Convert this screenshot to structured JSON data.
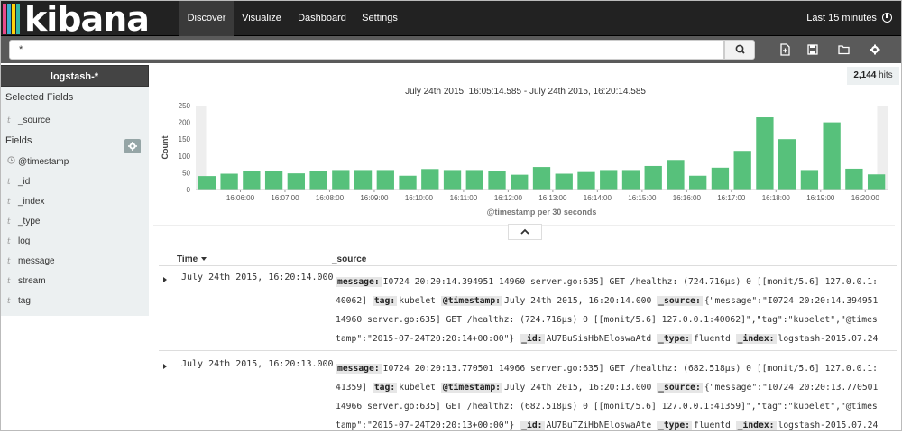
{
  "app": {
    "logo_text": "kibana",
    "logo_colors": [
      "#e8488b",
      "#3caed2",
      "#fed10a",
      "#32b8a6"
    ]
  },
  "nav": {
    "items": [
      {
        "label": "Discover",
        "active": true
      },
      {
        "label": "Visualize",
        "active": false
      },
      {
        "label": "Dashboard",
        "active": false
      },
      {
        "label": "Settings",
        "active": false
      }
    ],
    "time_range": "Last 15 minutes",
    "time_icon": "clock-icon"
  },
  "search": {
    "query": "*",
    "button_icon": "search-icon",
    "tools": [
      "new-search-icon",
      "save-icon",
      "open-icon",
      "settings-icon"
    ]
  },
  "sidebar": {
    "index_pattern": "logstash-*",
    "selected_fields_heading": "Selected Fields",
    "selected_fields": [
      {
        "type": "t",
        "name": "_source"
      }
    ],
    "fields_heading": "Fields",
    "gear_icon": "gear-icon",
    "fields": [
      {
        "type": "clock",
        "name": "@timestamp"
      },
      {
        "type": "t",
        "name": "_id"
      },
      {
        "type": "t",
        "name": "_index"
      },
      {
        "type": "t",
        "name": "_type"
      },
      {
        "type": "t",
        "name": "log"
      },
      {
        "type": "t",
        "name": "message"
      },
      {
        "type": "t",
        "name": "stream"
      },
      {
        "type": "t",
        "name": "tag"
      }
    ]
  },
  "hits": {
    "count": "2,144",
    "label": "hits"
  },
  "chart_data": {
    "type": "bar",
    "title": "July 24th 2015, 16:05:14.585 - July 24th 2015, 16:20:14.585",
    "xlabel": "@timestamp per 30 seconds",
    "ylabel": "Count",
    "ylim": [
      0,
      250
    ],
    "yticks": [
      0,
      50,
      100,
      150,
      200,
      250
    ],
    "color": "#57c17b",
    "xtick_labels": [
      "16:06:00",
      "16:07:00",
      "16:08:00",
      "16:09:00",
      "16:10:00",
      "16:11:00",
      "16:12:00",
      "16:13:00",
      "16:14:00",
      "16:15:00",
      "16:16:00",
      "16:17:00",
      "16:18:00",
      "16:19:00",
      "16:20:00"
    ],
    "values": [
      40,
      47,
      56,
      56,
      48,
      56,
      58,
      58,
      58,
      41,
      61,
      58,
      58,
      55,
      44,
      67,
      47,
      52,
      58,
      58,
      70,
      88,
      41,
      65,
      115,
      215,
      150,
      58,
      200,
      62,
      45
    ],
    "grid": false
  },
  "toggle_icon": "chevron-up-icon",
  "table": {
    "columns": [
      {
        "label": "Time",
        "sort_icon": "sort-down-icon"
      },
      {
        "label": "_source"
      }
    ],
    "rows": [
      {
        "time": "July 24th 2015, 16:20:14.000",
        "fields": [
          {
            "k": "message:",
            "v": "I0724 20:20:14.394951 14960 server.go:635] GET /healthz: (724.716µs) 0 [[monit/5.6] 127.0.0.1:40062]"
          },
          {
            "k": "tag:",
            "v": "kubelet"
          },
          {
            "k": "@timestamp:",
            "v": "July 24th 2015, 16:20:14.000"
          },
          {
            "k": "_source:",
            "v": "{\"message\":\"I0724 20:20:14.394951 14960 server.go:635] GET /healthz: (724.716µs) 0 [[monit/5.6] 127.0.0.1:40062]\",\"tag\":\"kubelet\",\"@timestamp\":\"2015-07-24T20:20:14+00:00\"}"
          },
          {
            "k": "_id:",
            "v": "AU7BuSisHbNEloswaAtd"
          },
          {
            "k": "_type:",
            "v": "fluentd"
          },
          {
            "k": "_index:",
            "v": "logstash-2015.07.24"
          }
        ]
      },
      {
        "time": "July 24th 2015, 16:20:13.000",
        "fields": [
          {
            "k": "message:",
            "v": "I0724 20:20:13.770501 14966 server.go:635] GET /healthz: (682.518µs) 0 [[monit/5.6] 127.0.0.1:41359]"
          },
          {
            "k": "tag:",
            "v": "kubelet"
          },
          {
            "k": "@timestamp:",
            "v": "July 24th 2015, 16:20:13.000"
          },
          {
            "k": "_source:",
            "v": "{\"message\":\"I0724 20:20:13.770501 14966 server.go:635] GET /healthz: (682.518µs) 0 [[monit/5.6] 127.0.0.1:41359]\",\"tag\":\"kubelet\",\"@timestamp\":\"2015-07-24T20:20:13+00:00\"}"
          },
          {
            "k": "_id:",
            "v": "AU7BuTZiHbNEloswaAte"
          },
          {
            "k": "_type:",
            "v": "fluentd"
          },
          {
            "k": "_index:",
            "v": "logstash-2015.07.24"
          }
        ]
      }
    ]
  }
}
